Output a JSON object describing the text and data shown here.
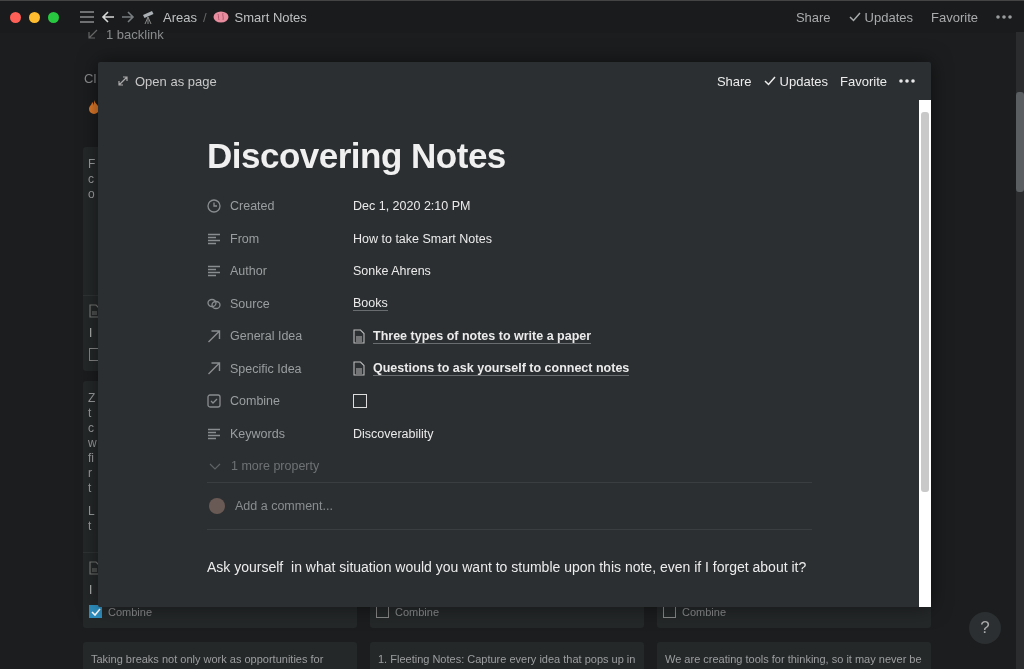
{
  "titlebar": {
    "breadcrumbs": [
      {
        "label": "Areas"
      },
      {
        "label": "Smart Notes"
      }
    ],
    "separator": "/",
    "actions": [
      {
        "kind": "text",
        "label": "Share"
      },
      {
        "kind": "check",
        "label": "Updates"
      },
      {
        "kind": "text",
        "label": "Favorite"
      }
    ]
  },
  "backlink": "1 backlink",
  "board": {
    "group_label": "Cl",
    "columns": [
      {
        "cards": [
          {
            "lines": [
              [
                "F",
                "c",
                "o"
              ]
            ],
            "footer": {
              "title": "I",
              "combine": {
                "checked": false
              }
            }
          },
          {
            "lines": [
              [
                "Z",
                "t",
                "c",
                "w",
                "fi",
                "r",
                "t"
              ],
              [
                "L",
                "t"
              ]
            ],
            "footer": {
              "title": "I",
              "combine": {
                "checked": true,
                "label": "Combine"
              }
            }
          },
          {
            "lines": [
              [
                "Taking breaks not only work as opportunities for"
              ]
            ]
          }
        ]
      },
      {
        "cards": [
          {
            "footer": {
              "combine": {
                "checked": false,
                "label": "Combine"
              }
            }
          },
          {
            "lines": [
              [
                "1.   Fleeting Notes: Capture every idea that pops up in"
              ]
            ]
          }
        ]
      },
      {
        "cards": [
          {
            "footer": {
              "combine": {
                "checked": false,
                "label": "Combine"
              }
            }
          },
          {
            "lines": [
              [
                "We are creating tools for thinking, so it may never be"
              ]
            ]
          }
        ]
      }
    ]
  },
  "modal": {
    "open_label": "Open as page",
    "actions": [
      {
        "kind": "text",
        "label": "Share"
      },
      {
        "kind": "check",
        "label": "Updates"
      },
      {
        "kind": "text",
        "label": "Favorite"
      }
    ],
    "title": "Discovering Notes",
    "properties": [
      {
        "label": "Created",
        "kind": "date",
        "value": "Dec 1, 2020 2:10 PM"
      },
      {
        "label": "From",
        "kind": "text",
        "value": "How to take Smart Notes"
      },
      {
        "label": "Author",
        "kind": "text",
        "value": "Sonke Ahrens"
      },
      {
        "label": "Source",
        "kind": "select",
        "value": "Books"
      },
      {
        "label": "General Idea",
        "kind": "page",
        "value": "Three types of notes to write a paper"
      },
      {
        "label": "Specific Idea",
        "kind": "page",
        "value": "Questions to ask yourself to connect notes"
      },
      {
        "label": "Combine",
        "kind": "checkbox",
        "checked": false
      },
      {
        "label": "Keywords",
        "kind": "text",
        "value": "Discoverability"
      }
    ],
    "more_properties": "1 more property",
    "comment_placeholder": "Add a comment...",
    "body": "Ask yourself  in what situation would you want to stumble upon this note, even if I forget about it?"
  },
  "help": "?"
}
